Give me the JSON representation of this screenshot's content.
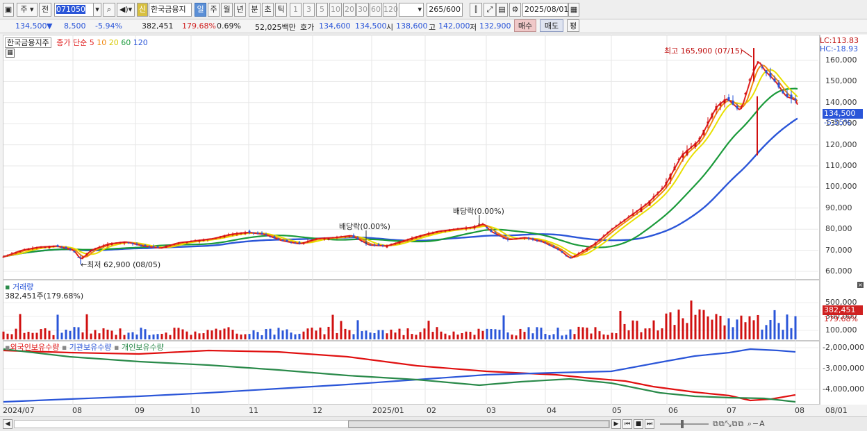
{
  "toolbar": {
    "market": "주",
    "prev": "전",
    "code": "071050",
    "stock_name": "한국금융지",
    "new_badge": "신",
    "periods": [
      "일",
      "주",
      "월",
      "년",
      "분",
      "초",
      "틱"
    ],
    "selected_period": "일",
    "intervals": [
      "1",
      "3",
      "5",
      "10",
      "20",
      "30",
      "60",
      "120"
    ],
    "count": "265",
    "count_max": "/600",
    "date": "2025/08/01"
  },
  "quote": {
    "price": "134,500",
    "arrow": "▼",
    "change": "8,500",
    "change_pct": "-5.94%",
    "volume": "382,451",
    "volume_ratio": "179.68%",
    "turnover": "0.69%",
    "amount": "52,025백만",
    "bid_label": "호가",
    "bid1": "134,600",
    "bid2": "134,500",
    "open_label": "시",
    "open": "138,600",
    "high_label": "고",
    "high": "142,000",
    "low_label": "저",
    "low": "132,900",
    "buy": "매수",
    "sell": "매도",
    "eval": "평"
  },
  "price_pane": {
    "name": "한국금융지주",
    "ma_label": "종가 단순",
    "ma_periods": [
      {
        "p": "5",
        "color": "#e02020"
      },
      {
        "p": "10",
        "color": "#f08a10"
      },
      {
        "p": "20",
        "color": "#e8e000"
      },
      {
        "p": "60",
        "color": "#1a9a3a"
      },
      {
        "p": "120",
        "color": "#2a55d8"
      }
    ],
    "lc": "LC:113.83",
    "hc": "HC:-18.93",
    "current_tag": "134,500",
    "current_pct": "-5.55%",
    "annotations": {
      "high": "최고 165,900 (07/15)",
      "low": "←최저 62,900 (08/05)",
      "div1": "배당락(0.00%)",
      "div2": "배당락(0.00%)"
    }
  },
  "volume_pane": {
    "name": "거래량",
    "value": "382,451주(179.68%)",
    "tag": "382,451",
    "tag_pct": "179.68%"
  },
  "holder_pane": {
    "series": [
      "외국인보유수량",
      "기관보유수량",
      "개인보유수량"
    ],
    "colors": [
      "#e01010",
      "#2a55d8",
      "#2a8a4a"
    ]
  },
  "chart_data": {
    "type": "line",
    "price_ticks": [
      "160,000",
      "150,000",
      "140,000",
      "130,000",
      "120,000",
      "110,000",
      "100,000",
      "90,000",
      "80,000",
      "70,000",
      "60,000"
    ],
    "volume_ticks": [
      "500,000",
      "300,000",
      "100,000"
    ],
    "holder_ticks": [
      "-2,000,000",
      "-3,000,000",
      "-4,000,000"
    ],
    "x_labels": [
      "2024/07",
      "08",
      "09",
      "10",
      "11",
      "12",
      "2025/01",
      "02",
      "03",
      "04",
      "05",
      "06",
      "07",
      "08",
      "08/01"
    ],
    "close": [
      {
        "t": 0,
        "v": 67000
      },
      {
        "t": 25,
        "v": 70000
      },
      {
        "t": 50,
        "v": 71500
      },
      {
        "t": 75,
        "v": 72000
      },
      {
        "t": 100,
        "v": 70000
      },
      {
        "t": 110,
        "v": 65500
      },
      {
        "t": 125,
        "v": 70000
      },
      {
        "t": 150,
        "v": 73000
      },
      {
        "t": 175,
        "v": 74000
      },
      {
        "t": 200,
        "v": 72000
      },
      {
        "t": 225,
        "v": 71000
      },
      {
        "t": 250,
        "v": 73500
      },
      {
        "t": 275,
        "v": 74500
      },
      {
        "t": 300,
        "v": 75500
      },
      {
        "t": 325,
        "v": 77500
      },
      {
        "t": 350,
        "v": 78500
      },
      {
        "t": 375,
        "v": 77500
      },
      {
        "t": 400,
        "v": 74500
      },
      {
        "t": 425,
        "v": 73000
      },
      {
        "t": 450,
        "v": 75500
      },
      {
        "t": 475,
        "v": 76000
      },
      {
        "t": 500,
        "v": 77000
      },
      {
        "t": 525,
        "v": 72500
      },
      {
        "t": 550,
        "v": 72000
      },
      {
        "t": 575,
        "v": 74500
      },
      {
        "t": 600,
        "v": 77000
      },
      {
        "t": 625,
        "v": 79000
      },
      {
        "t": 650,
        "v": 80000
      },
      {
        "t": 675,
        "v": 81000
      },
      {
        "t": 690,
        "v": 82500
      },
      {
        "t": 700,
        "v": 79000
      },
      {
        "t": 725,
        "v": 75000
      },
      {
        "t": 750,
        "v": 76000
      },
      {
        "t": 775,
        "v": 74000
      },
      {
        "t": 800,
        "v": 70000
      },
      {
        "t": 815,
        "v": 66000
      },
      {
        "t": 830,
        "v": 69000
      },
      {
        "t": 850,
        "v": 73000
      },
      {
        "t": 875,
        "v": 80000
      },
      {
        "t": 900,
        "v": 86000
      },
      {
        "t": 925,
        "v": 92000
      },
      {
        "t": 950,
        "v": 100000
      },
      {
        "t": 975,
        "v": 115000
      },
      {
        "t": 1000,
        "v": 122000
      },
      {
        "t": 1025,
        "v": 138000
      },
      {
        "t": 1040,
        "v": 142000
      },
      {
        "t": 1060,
        "v": 136000
      },
      {
        "t": 1075,
        "v": 152000
      },
      {
        "t": 1085,
        "v": 160000
      },
      {
        "t": 1095,
        "v": 155000
      },
      {
        "t": 1110,
        "v": 150000
      },
      {
        "t": 1125,
        "v": 143000
      },
      {
        "t": 1140,
        "v": 141000
      },
      {
        "t": 1145,
        "v": 134500
      }
    ]
  }
}
